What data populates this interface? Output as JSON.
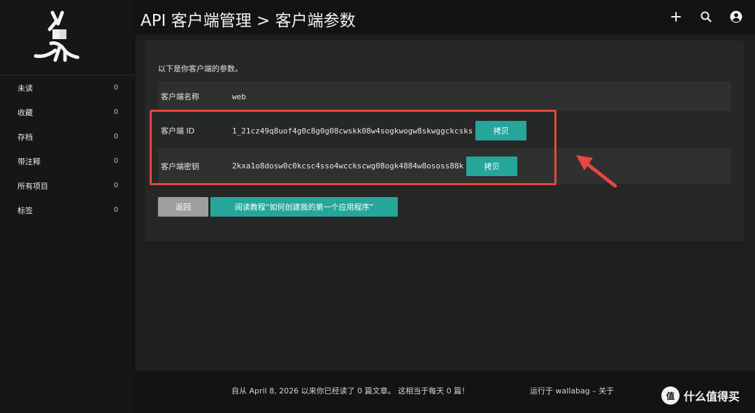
{
  "app": {
    "title": "API 客户端管理 > 客户端参数"
  },
  "sidebar": {
    "items": [
      {
        "label": "未读",
        "count": "0"
      },
      {
        "label": "收藏",
        "count": "0"
      },
      {
        "label": "存档",
        "count": "0"
      },
      {
        "label": "带注释",
        "count": "0"
      },
      {
        "label": "所有项目",
        "count": "0"
      },
      {
        "label": "标签",
        "count": "0"
      }
    ]
  },
  "topbar": {
    "icons": [
      "plus-icon",
      "search-icon",
      "account-icon"
    ]
  },
  "content": {
    "intro": "以下是你客户端的参数。",
    "rows": [
      {
        "label": "客户端名称",
        "value": "web"
      },
      {
        "label": "客户端 ID",
        "value": "1_21cz49q8uof4g0c8g0g08cwskk08w4sogkwogw8skwggckcsks",
        "copy_label": "拷贝"
      },
      {
        "label": "客户端密钥",
        "value": "2kxa1o8dosw0c0kcsc4sso4wcckscwg08ogk4884w8ososs88k",
        "copy_label": "拷贝"
      }
    ],
    "back_label": "返回",
    "tutorial_label": "阅读教程“如何创建我的第一个应用程序”"
  },
  "footer": {
    "stats": "自从 April 8, 2026 以来你已经读了 0 篇文章。 这相当于每天 0 篇！",
    "powered": "运行于 wallabag – 关于"
  },
  "watermark": {
    "badge": "值",
    "text": "什么值得买"
  },
  "colors": {
    "accent": "#26a69a",
    "highlight": "#e8473f",
    "back_button": "#9e9e9e"
  }
}
